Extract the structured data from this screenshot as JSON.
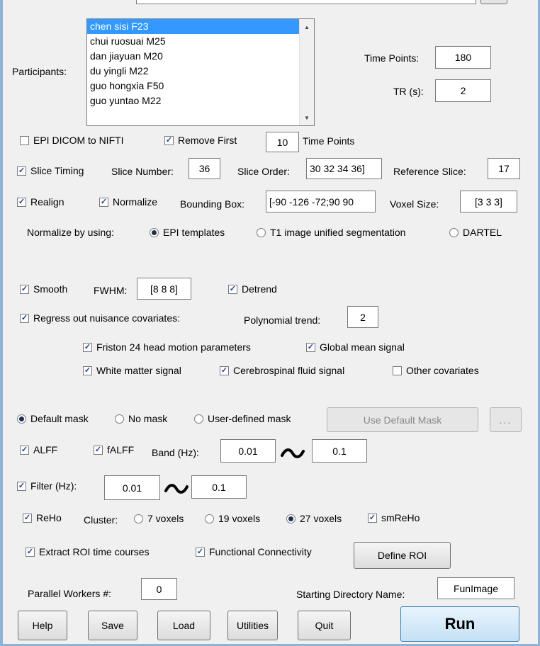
{
  "participants": {
    "label": "Participants:",
    "items": [
      "chen sisi F23",
      "chui ruosuai M25",
      "dan jiayuan M20",
      "du yingli M22",
      "guo hongxia F50",
      "guo yuntao M22"
    ],
    "selected_index": 0
  },
  "time_points": {
    "label": "Time Points:",
    "value": "180"
  },
  "tr": {
    "label": "TR (s):",
    "value": "2"
  },
  "epi_dicom": {
    "label": "EPI DICOM to NIFTI",
    "checked": false
  },
  "remove_first": {
    "label": "Remove First",
    "value": "10",
    "suffix": "Time Points",
    "checked": true
  },
  "slice_timing": {
    "label": "Slice Timing",
    "checked": true,
    "slice_number_label": "Slice Number:",
    "slice_number": "36",
    "slice_order_label": "Slice Order:",
    "slice_order": "30 32 34 36]",
    "reference_slice_label": "Reference Slice:",
    "reference_slice": "17"
  },
  "realign": {
    "label": "Realign",
    "checked": true
  },
  "normalize": {
    "label": "Normalize",
    "checked": true,
    "bounding_box_label": "Bounding Box:",
    "bounding_box": "[-90 -126 -72;90 90",
    "voxel_size_label": "Voxel Size:",
    "voxel_size": "[3 3 3]",
    "by_label": "Normalize by using:",
    "options": [
      "EPI templates",
      "T1 image unified segmentation",
      "DARTEL"
    ],
    "selected": 0
  },
  "smooth": {
    "label": "Smooth",
    "checked": true,
    "fwhm_label": "FWHM:",
    "fwhm": "[8 8 8]"
  },
  "detrend": {
    "label": "Detrend",
    "checked": true
  },
  "regress": {
    "label": "Regress out nuisance covariates:",
    "checked": true,
    "poly_label": "Polynomial trend:",
    "poly": "2",
    "friston": {
      "label": "Friston 24 head motion parameters",
      "checked": true
    },
    "global": {
      "label": "Global mean signal",
      "checked": true
    },
    "white": {
      "label": "White matter signal",
      "checked": true
    },
    "csf": {
      "label": "Cerebrospinal fluid signal",
      "checked": true
    },
    "other": {
      "label": "Other covariates",
      "checked": false
    }
  },
  "mask": {
    "options": [
      "Default mask",
      "No mask",
      "User-defined mask"
    ],
    "selected": 0,
    "use_default_label": "Use Default Mask",
    "browse_label": "..."
  },
  "alff": {
    "alff_label": "ALFF",
    "alff_checked": true,
    "falff_label": "fALFF",
    "falff_checked": true,
    "band_label": "Band (Hz):",
    "low": "0.01",
    "high": "0.1"
  },
  "filter": {
    "label": "Filter (Hz):",
    "checked": true,
    "low": "0.01",
    "high": "0.1"
  },
  "reho": {
    "label": "ReHo",
    "checked": true,
    "cluster_label": "Cluster:",
    "options": [
      "7 voxels",
      "19 voxels",
      "27 voxels"
    ],
    "selected": 2,
    "smreho_label": "smReHo",
    "smreho_checked": true
  },
  "roi": {
    "extract_label": "Extract ROI time courses",
    "extract_checked": true,
    "fc_label": "Functional Connectivity",
    "fc_checked": true,
    "define_label": "Define ROI"
  },
  "workers": {
    "label": "Parallel Workers #:",
    "value": "0"
  },
  "start_dir": {
    "label": "Starting Directory Name:",
    "value": "FunImage"
  },
  "buttons": {
    "help": "Help",
    "save": "Save",
    "load": "Load",
    "utilities": "Utilities",
    "quit": "Quit",
    "run": "Run"
  },
  "check_glyph": "✓"
}
